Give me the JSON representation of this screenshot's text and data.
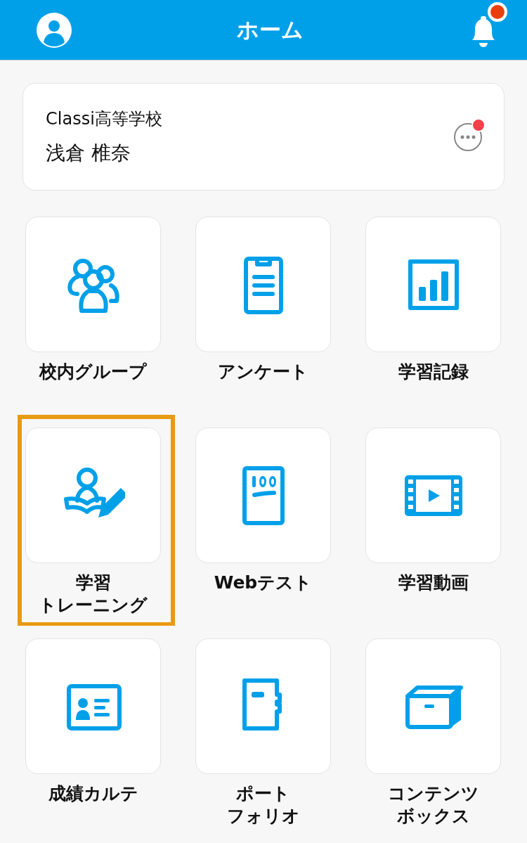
{
  "header": {
    "title": "ホーム",
    "notification_badge": true
  },
  "profile": {
    "school": "Classi高等学校",
    "name": "浅倉 椎奈",
    "more_badge": true
  },
  "menu": [
    {
      "kind": "groups",
      "label": [
        "校内グループ"
      ],
      "highlighted": false
    },
    {
      "kind": "survey",
      "label": [
        "アンケート"
      ],
      "highlighted": false
    },
    {
      "kind": "records",
      "label": [
        "学習記録"
      ],
      "highlighted": false
    },
    {
      "kind": "training",
      "label": [
        "学習",
        "トレーニング"
      ],
      "highlighted": true
    },
    {
      "kind": "webtest",
      "label": [
        "Webテスト"
      ],
      "highlighted": false
    },
    {
      "kind": "video",
      "label": [
        "学習動画"
      ],
      "highlighted": false
    },
    {
      "kind": "chart",
      "label": [
        "成績カルテ"
      ],
      "highlighted": false
    },
    {
      "kind": "portfolio",
      "label": [
        "ポート",
        "フォリオ"
      ],
      "highlighted": false
    },
    {
      "kind": "box",
      "label": [
        "コンテンツ",
        "ボックス"
      ],
      "highlighted": false
    }
  ]
}
